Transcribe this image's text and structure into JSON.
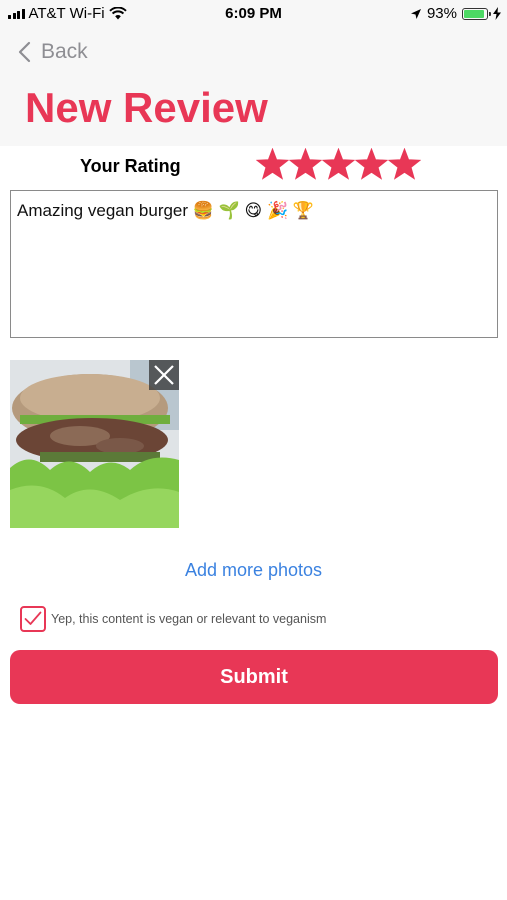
{
  "status_bar": {
    "carrier": "AT&T Wi-Fi",
    "time": "6:09 PM",
    "battery_percent": "93%",
    "battery_level": 0.93
  },
  "nav": {
    "back_label": "Back",
    "title": "New Review"
  },
  "rating": {
    "label": "Your Rating",
    "value": 5,
    "max": 5
  },
  "review": {
    "text": "Amazing vegan burger 🍔 🌱 😋 🎉 🏆"
  },
  "photos": {
    "add_more_label": "Add more photos"
  },
  "confirm": {
    "label": "Yep, this content is vegan or relevant to veganism",
    "checked": true
  },
  "submit_label": "Submit",
  "colors": {
    "accent": "#e83756",
    "link": "#3b82e0",
    "header_bg": "#f7f7f7"
  }
}
